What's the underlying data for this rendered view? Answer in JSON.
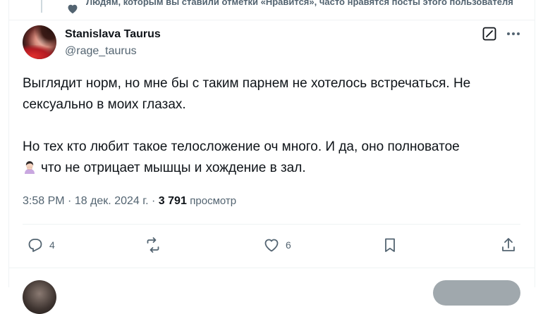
{
  "social_context": {
    "text": "Людям, которым вы ставили отметки «Нравится», часто нравятся посты этого пользователя"
  },
  "author": {
    "display_name": "Stanislava Taurus",
    "handle": "@rage_taurus"
  },
  "tweet": {
    "paragraph1_line1": "Выглядит норм, но мне бы с таким парнем не хотелось встречаться. Не",
    "paragraph1_line2": "сексуально в моих глазах.",
    "paragraph2_line1": "Но тех кто любит такое телосложение оч много. И да, оно полноватое",
    "paragraph2_line2": "что не отрицает мышцы и хождение в зал."
  },
  "meta": {
    "time": "3:58 PM",
    "separator": "·",
    "date": "18 дек. 2024 г.",
    "separator2": "·",
    "views_count": "3 791",
    "views_label": "просмотр"
  },
  "actions": {
    "reply_count": "4",
    "like_count": "6"
  },
  "icons": {
    "social_context": "heart-icon",
    "grok": "grok-icon",
    "more": "more-icon",
    "reply": "reply-icon",
    "retweet": "retweet-icon",
    "like": "heart-icon",
    "bookmark": "bookmark-icon",
    "share": "share-icon",
    "emoji": "woman-facepalming-emoji"
  },
  "colors": {
    "text": "#0f1419",
    "secondary": "#536471",
    "divider": "#eff3f4"
  }
}
